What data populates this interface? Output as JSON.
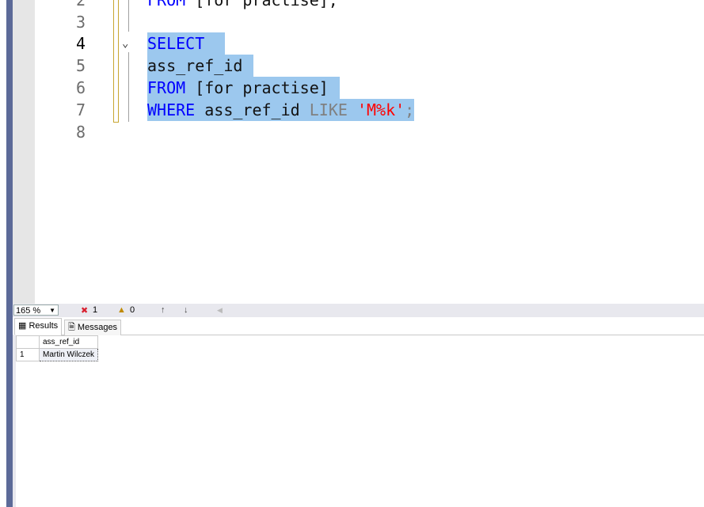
{
  "editor": {
    "lines": [
      {
        "num": "2",
        "parts": [
          "FROM",
          "[for practise];"
        ]
      },
      {
        "num": "3"
      },
      {
        "num": "4",
        "parts": [
          "SELECT"
        ]
      },
      {
        "num": "5",
        "parts": [
          "ass_ref_id"
        ]
      },
      {
        "num": "6",
        "parts": [
          "FROM",
          "[for practise]"
        ]
      },
      {
        "num": "7",
        "parts": [
          "WHERE",
          "ass_ref_id",
          "LIKE",
          "'M%k'",
          ";"
        ]
      },
      {
        "num": "8"
      }
    ]
  },
  "status": {
    "zoom": "165 %",
    "errors": "1",
    "warnings": "0"
  },
  "tabs": {
    "results": "Results",
    "messages": "Messages"
  },
  "grid": {
    "header": "ass_ref_id",
    "rows": [
      {
        "num": "1",
        "value": "Martin Wilczek"
      }
    ]
  }
}
